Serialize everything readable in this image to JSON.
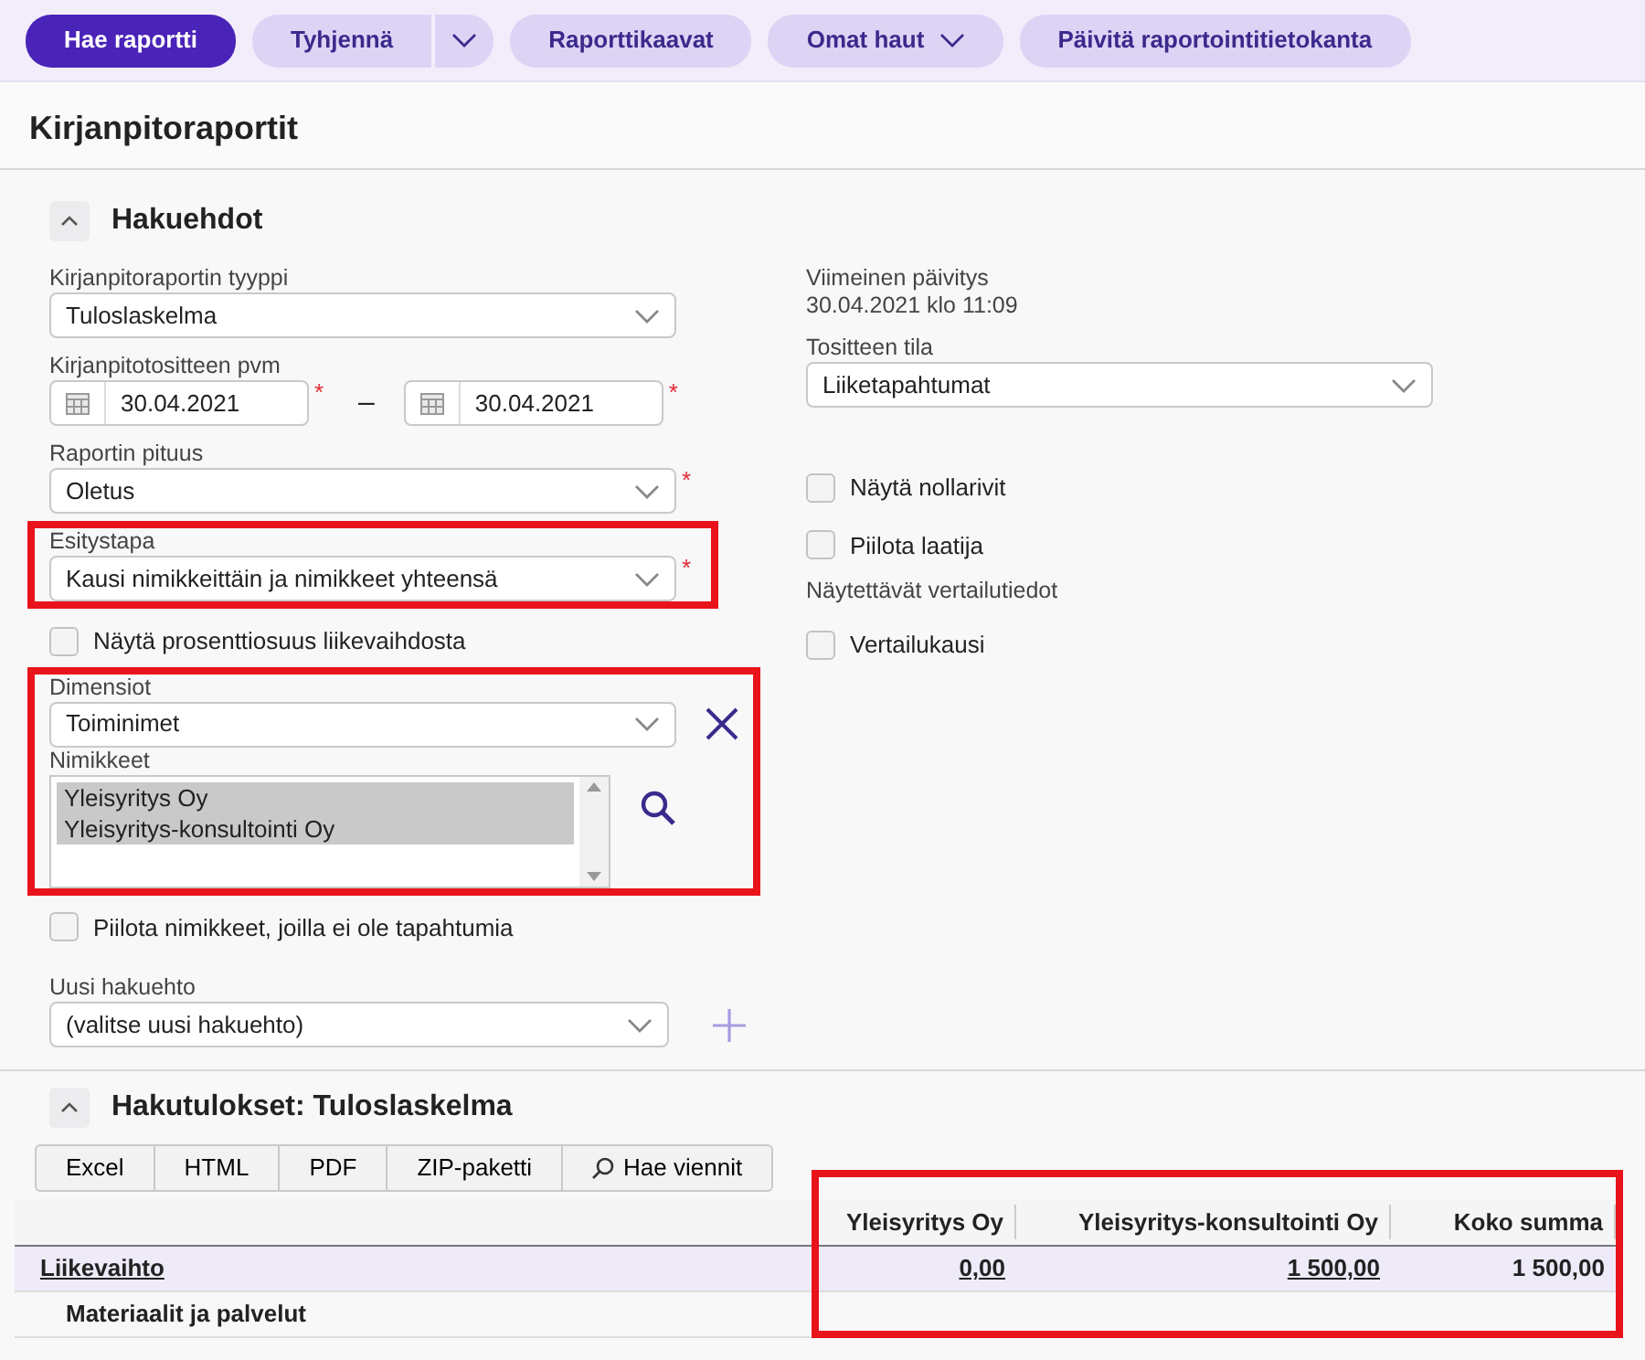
{
  "toolbar": {
    "buttons": [
      {
        "label": "Hae raportti",
        "kind": "primary"
      },
      {
        "label": "Tyhjennä",
        "kind": "split"
      },
      {
        "label": "Raporttikaavat",
        "kind": "plain"
      },
      {
        "label": "Omat haut",
        "kind": "dropdown"
      },
      {
        "label": "Päivitä raportointitietokanta",
        "kind": "plain"
      }
    ]
  },
  "page_title": "Kirjanpitoraportit",
  "search_section": {
    "title": "Hakuehdot",
    "expanded": true,
    "left": [
      {
        "kind": "select",
        "label": "Kirjanpitoraportin tyyppi",
        "value": "Tuloslaskelma"
      },
      {
        "kind": "daterange",
        "label": "Kirjanpitotositteen pvm",
        "from": "30.04.2021",
        "from_mark": "*",
        "separator": "–",
        "to": "30.04.2021",
        "to_mark": "*"
      },
      {
        "kind": "select",
        "label": "Raportin pituus",
        "value": "Oletus",
        "required_mark": "*"
      },
      {
        "kind": "select",
        "label": "Esitystapa",
        "value": "Kausi nimikkeittäin ja nimikkeet yhteensä",
        "required_mark": "*",
        "highlighted": true
      },
      {
        "kind": "checkbox",
        "label": "Näytä prosenttiosuus liikevaihdosta",
        "checked": false
      },
      {
        "kind": "dimension",
        "label": "Dimensiot",
        "value": "Toiminimet",
        "list_label": "Nimikkeet",
        "highlighted": true,
        "items": [
          {
            "label": "Yleisyritys Oy",
            "selected": true
          },
          {
            "label": "Yleisyritys-konsultointi Oy",
            "selected": true
          }
        ]
      },
      {
        "kind": "checkbox",
        "label": "Piilota nimikkeet, joilla ei ole tapahtumia",
        "checked": false
      },
      {
        "kind": "select_add",
        "label": "Uusi hakuehto",
        "value": "(valitse uusi hakuehto)"
      }
    ],
    "right": [
      {
        "kind": "info",
        "label": "Viimeinen päivitys",
        "value": "30.04.2021 klo 11:09"
      },
      {
        "kind": "select",
        "label": "Tositteen tila",
        "value": "Liiketapahtumat"
      },
      {
        "kind": "checkbox",
        "label": "Näytä nollarivit",
        "checked": false
      },
      {
        "kind": "checkbox",
        "label": "Piilota laatija",
        "checked": false
      },
      {
        "kind": "heading",
        "label": "Näytettävät vertailutiedot"
      },
      {
        "kind": "checkbox",
        "label": "Vertailukausi",
        "checked": false
      }
    ]
  },
  "results_section": {
    "title": "Hakutulokset: Tuloslaskelma",
    "expanded": true,
    "exports": [
      {
        "label": "Excel",
        "kind": "plain"
      },
      {
        "label": "HTML",
        "kind": "plain"
      },
      {
        "label": "PDF",
        "kind": "plain"
      },
      {
        "label": "ZIP-paketti",
        "kind": "plain"
      },
      {
        "label": "Hae viennit",
        "kind": "search"
      }
    ],
    "table": {
      "highlighted": true,
      "columns": [
        "Yleisyritys Oy",
        "Yleisyritys-konsultointi Oy",
        "Koko summa"
      ],
      "rows": [
        {
          "label": "Liikevaihto",
          "kind": "total",
          "cells": [
            {
              "text": "0,00",
              "link": true
            },
            {
              "text": "1 500,00",
              "link": true
            },
            {
              "text": "1 500,00",
              "link": false
            }
          ]
        },
        {
          "label": "Materiaalit ja palvelut",
          "kind": "item",
          "cells": []
        }
      ]
    }
  }
}
